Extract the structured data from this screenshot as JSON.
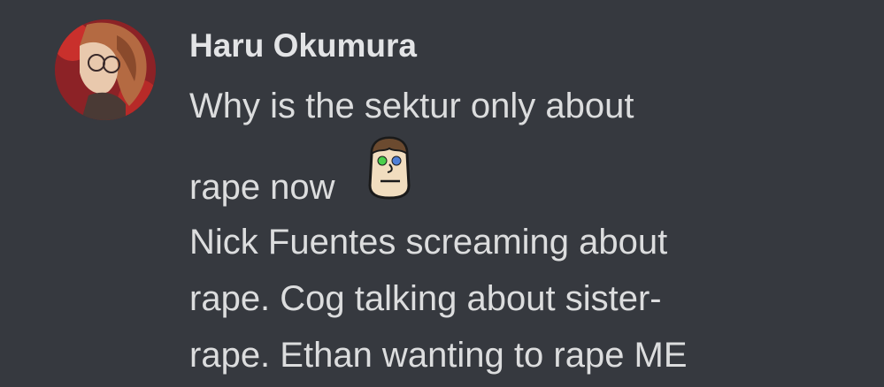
{
  "message": {
    "author": "Haru Okumura",
    "lines": [
      "Why is the sektur only about",
      "rape now",
      "Nick Fuentes screaming about",
      "rape. Cog talking about sister-",
      "rape. Ethan wanting to rape ME"
    ],
    "inline_emoji": "custom-face-emoji"
  },
  "colors": {
    "background": "#36393f",
    "author_text": "#e3e4e6",
    "message_text": "#dcddde"
  }
}
